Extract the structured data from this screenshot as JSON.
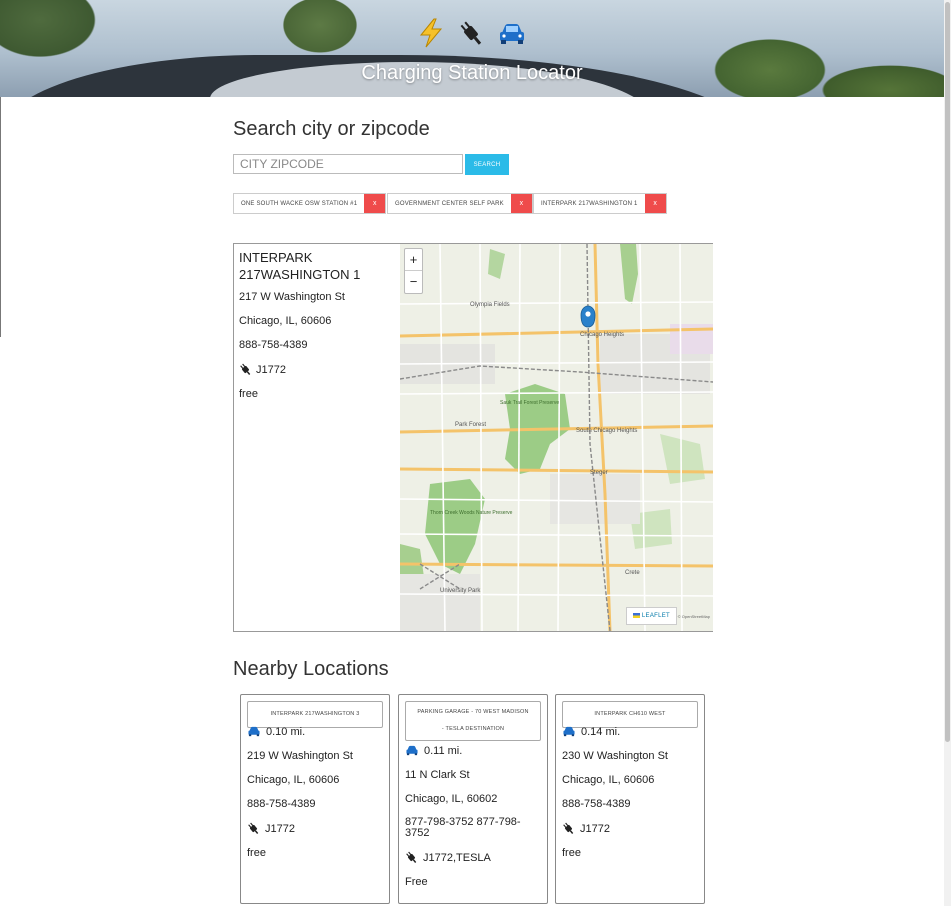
{
  "header": {
    "icons": [
      "lightning-icon",
      "plug-icon",
      "car-icon"
    ],
    "title": "Charging Station Locator"
  },
  "search": {
    "heading": "Search city or zipcode",
    "placeholder": "CITY ZIPCODE",
    "button_label": "SEARCH"
  },
  "recent": [
    {
      "label": "ONE SOUTH WACKE OSW STATION #1",
      "remove": "x"
    },
    {
      "label": "GOVERNMENT CENTER SELF PARK",
      "remove": "x"
    },
    {
      "label": "INTERPARK 217WASHINGTON 1",
      "remove": "x"
    }
  ],
  "selected": {
    "name": "INTERPARK 217WASHINGTON 1",
    "address": "217 W Washington St",
    "city_state_zip": "Chicago, IL, 60606",
    "phone": "888-758-4389",
    "connectors": "J1772",
    "price": "free"
  },
  "map": {
    "zoom_in": "+",
    "zoom_out": "−",
    "attribution_label": "LEAFLET",
    "osm_attribution": "© OpenStreetMap",
    "place_labels": [
      "Olympia Fields",
      "Chicago Heights",
      "Sauk Trail Forest Preserve",
      "Park Forest",
      "South Chicago Heights",
      "Steger",
      "Crete",
      "University Park",
      "Thorn Creek Woods Nature Preserve"
    ]
  },
  "nearby": {
    "heading": "Nearby Locations",
    "items": [
      {
        "title": "INTERPARK 217WASHINGTON 3",
        "distance": "0.10 mi.",
        "address": "219 W Washington St",
        "city_state_zip": "Chicago, IL, 60606",
        "phone": "888-758-4389",
        "connectors": "J1772",
        "price": "free"
      },
      {
        "title": "PARKING GARAGE - 70 WEST MADISON - TESLA DESTINATION",
        "distance": "0.11 mi.",
        "address": "11 N Clark St",
        "city_state_zip": "Chicago, IL, 60602",
        "phone": "877-798-3752 877-798-3752",
        "connectors": "J1772,TESLA",
        "price": "Free"
      },
      {
        "title": "INTERPARK CH610 WEST",
        "distance": "0.14 mi.",
        "address": "230 W Washington St",
        "city_state_zip": "Chicago, IL, 60606",
        "phone": "888-758-4389",
        "connectors": "J1772",
        "price": "free"
      }
    ]
  },
  "colors": {
    "accent": "#2bbbe8",
    "remove": "#ef4b4b",
    "marker": "#2a81cb"
  }
}
